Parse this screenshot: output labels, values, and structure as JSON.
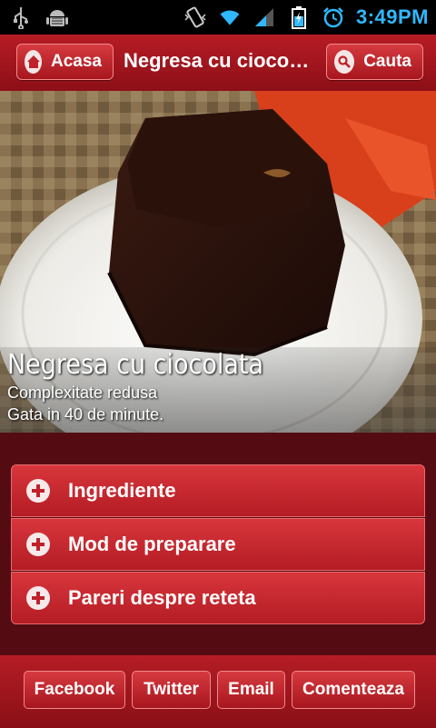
{
  "status_bar": {
    "time": "3:49PM",
    "icons": [
      "usb-icon",
      "android-debug-icon",
      "vibrate-icon",
      "wifi-icon",
      "signal-icon",
      "battery-charging-icon",
      "alarm-icon"
    ]
  },
  "header": {
    "home_label": "Acasa",
    "title": "Negresa cu ciocolata",
    "search_label": "Cauta"
  },
  "recipe": {
    "title": "Negresa cu ciocolata",
    "complexity": "Complexitate redusa",
    "time": "Gata in 40 de minute."
  },
  "sections": [
    {
      "label": "Ingrediente"
    },
    {
      "label": "Mod de preparare"
    },
    {
      "label": "Pareri despre reteta"
    }
  ],
  "footer": {
    "buttons": [
      {
        "label": "Facebook"
      },
      {
        "label": "Twitter"
      },
      {
        "label": "Email"
      },
      {
        "label": "Comenteaza"
      }
    ]
  },
  "colors": {
    "brand_red": "#b61c25",
    "dark_red": "#540c12",
    "time_blue": "#2fb8ff"
  }
}
